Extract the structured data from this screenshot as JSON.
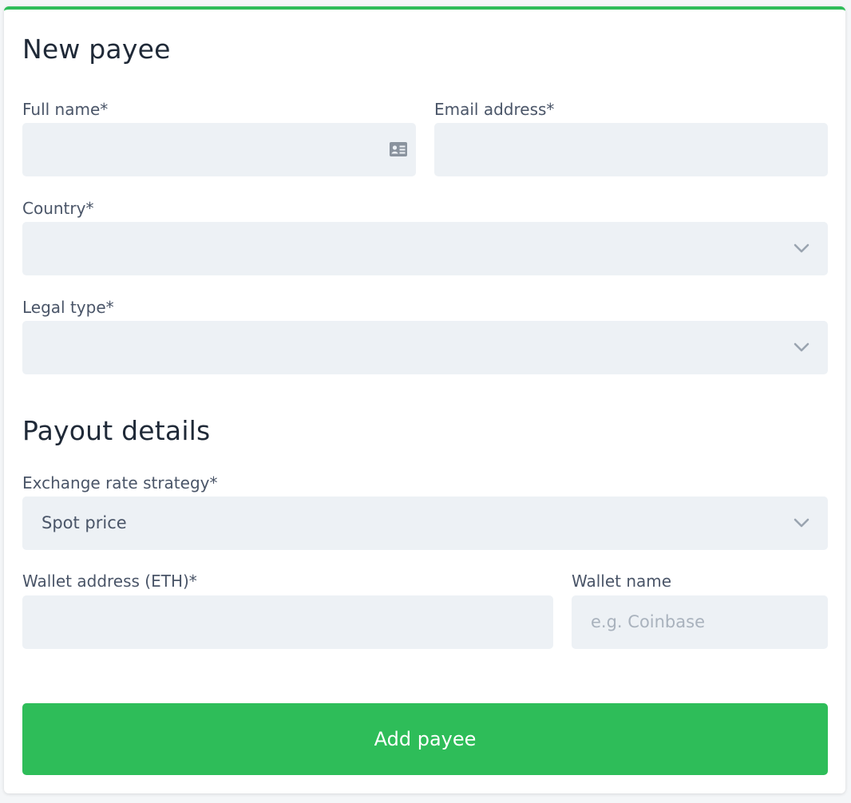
{
  "section_new_payee": {
    "title": "New payee"
  },
  "full_name": {
    "label": "Full name*",
    "value": ""
  },
  "email": {
    "label": "Email address*",
    "value": ""
  },
  "country": {
    "label": "Country*",
    "value": ""
  },
  "legal_type": {
    "label": "Legal type*",
    "value": ""
  },
  "section_payout": {
    "title": "Payout details"
  },
  "exchange_rate": {
    "label": "Exchange rate strategy*",
    "value": "Spot price"
  },
  "wallet_address": {
    "label": "Wallet address (ETH)*",
    "value": ""
  },
  "wallet_name": {
    "label": "Wallet name",
    "placeholder": "e.g. Coinbase"
  },
  "submit": {
    "label": "Add payee"
  },
  "colors": {
    "accent": "#2ebd59",
    "field_bg": "#edf1f5"
  },
  "icons": {
    "full_name_field": "id-card-icon",
    "select": "chevron-down-icon"
  }
}
